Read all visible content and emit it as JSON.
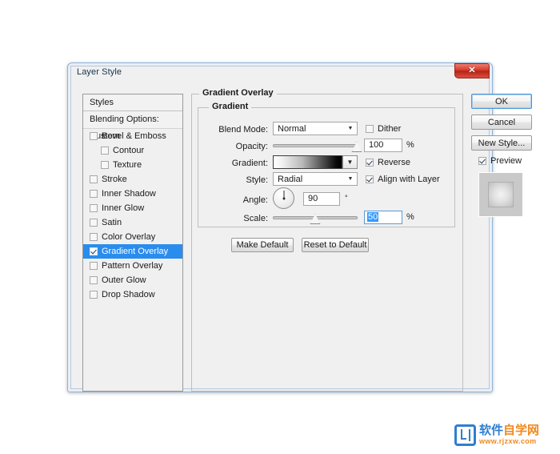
{
  "window": {
    "title": "Layer Style",
    "close_label": "✕"
  },
  "styles_panel": {
    "header": "Styles",
    "blending_options": "Blending Options: Custom",
    "items": [
      {
        "label": "Bevel & Emboss",
        "checked": false,
        "indent": false,
        "selected": false
      },
      {
        "label": "Contour",
        "checked": false,
        "indent": true,
        "selected": false
      },
      {
        "label": "Texture",
        "checked": false,
        "indent": true,
        "selected": false
      },
      {
        "label": "Stroke",
        "checked": false,
        "indent": false,
        "selected": false
      },
      {
        "label": "Inner Shadow",
        "checked": false,
        "indent": false,
        "selected": false
      },
      {
        "label": "Inner Glow",
        "checked": false,
        "indent": false,
        "selected": false
      },
      {
        "label": "Satin",
        "checked": false,
        "indent": false,
        "selected": false
      },
      {
        "label": "Color Overlay",
        "checked": false,
        "indent": false,
        "selected": false
      },
      {
        "label": "Gradient Overlay",
        "checked": true,
        "indent": false,
        "selected": true
      },
      {
        "label": "Pattern Overlay",
        "checked": false,
        "indent": false,
        "selected": false
      },
      {
        "label": "Outer Glow",
        "checked": false,
        "indent": false,
        "selected": false
      },
      {
        "label": "Drop Shadow",
        "checked": false,
        "indent": false,
        "selected": false
      }
    ]
  },
  "main": {
    "group_title": "Gradient Overlay",
    "subgroup_title": "Gradient",
    "blend_mode": {
      "label": "Blend Mode:",
      "value": "Normal"
    },
    "opacity": {
      "label": "Opacity:",
      "value": "100",
      "unit": "%",
      "percent": 100
    },
    "gradient": {
      "label": "Gradient:",
      "from": "#ffffff",
      "to": "#000000"
    },
    "style": {
      "label": "Style:",
      "value": "Radial"
    },
    "angle": {
      "label": "Angle:",
      "value": "90",
      "unit": "°",
      "degrees": 90
    },
    "scale": {
      "label": "Scale:",
      "value": "50",
      "unit": "%",
      "percent": 50
    },
    "dither": {
      "label": "Dither",
      "checked": false
    },
    "reverse": {
      "label": "Reverse",
      "checked": true
    },
    "align": {
      "label": "Align with Layer",
      "checked": true
    },
    "make_default": "Make Default",
    "reset_default": "Reset to Default"
  },
  "right_column": {
    "ok": "OK",
    "cancel": "Cancel",
    "new_style": "New Style...",
    "preview": {
      "label": "Preview",
      "checked": true
    }
  },
  "watermark": {
    "cn_blue": "软件",
    "cn_orange": "自学网",
    "url": "www.rjzxw.com"
  }
}
